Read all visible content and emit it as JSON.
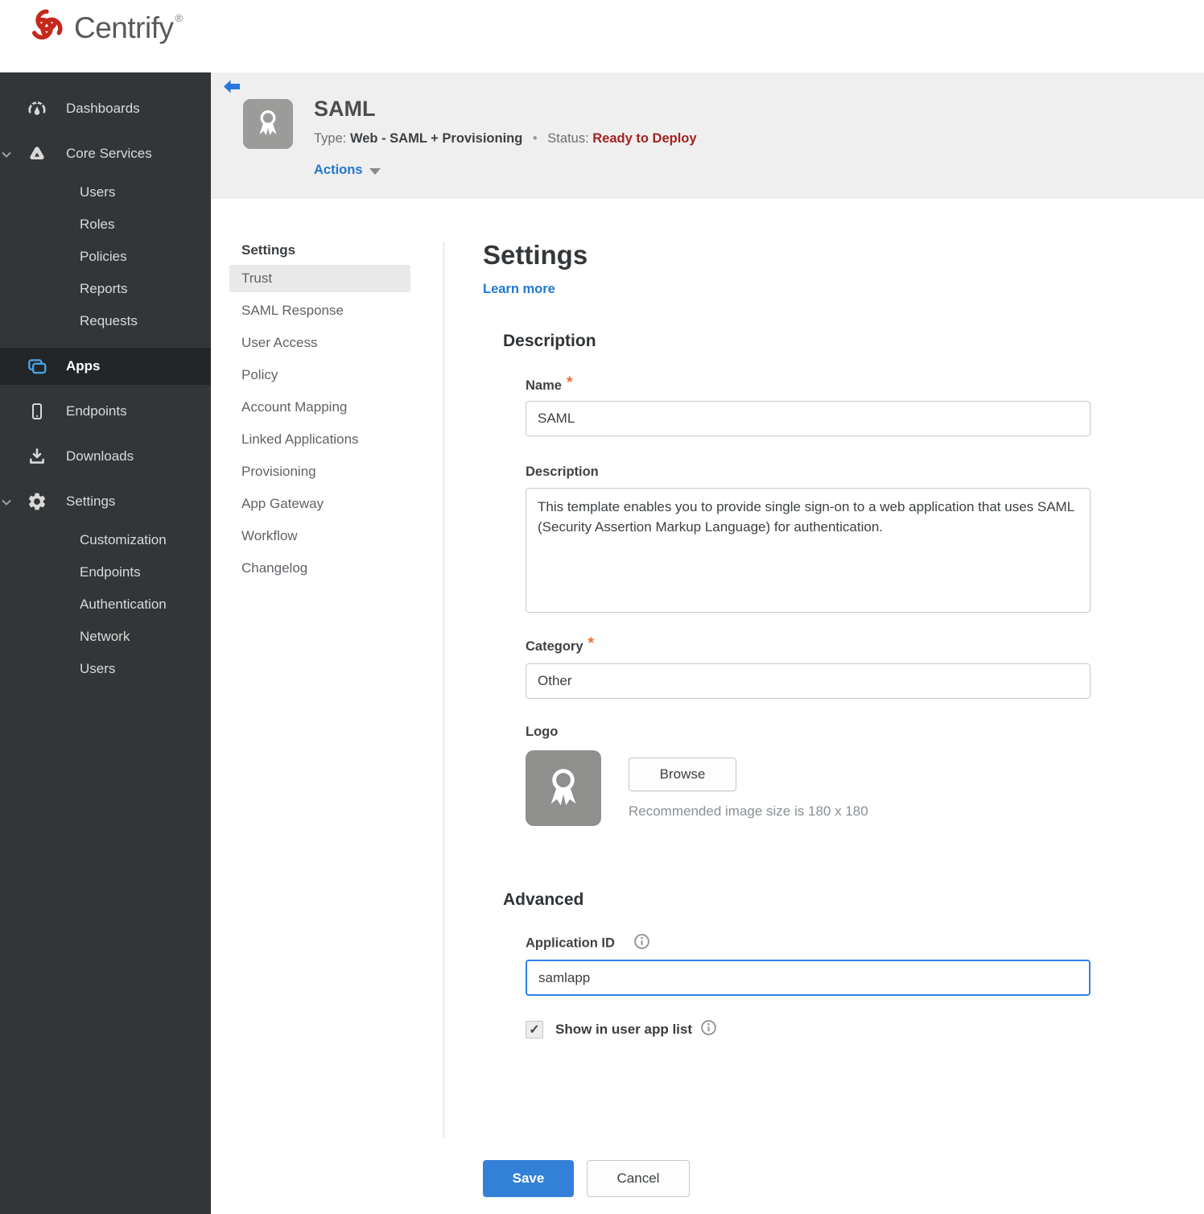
{
  "brand": {
    "name": "Centrify",
    "registered_mark": "®"
  },
  "sidebar": {
    "items": [
      {
        "label": "Dashboards",
        "icon": "gauge-icon"
      },
      {
        "label": "Core Services",
        "icon": "network-icon",
        "expanded": true,
        "children": [
          "Users",
          "Roles",
          "Policies",
          "Reports",
          "Requests"
        ]
      },
      {
        "label": "Apps",
        "icon": "apps-icon",
        "selected": true
      },
      {
        "label": "Endpoints",
        "icon": "phone-icon"
      },
      {
        "label": "Downloads",
        "icon": "download-icon"
      },
      {
        "label": "Settings",
        "icon": "gear-icon",
        "expanded": true,
        "children": [
          "Customization",
          "Endpoints",
          "Authentication",
          "Network",
          "Users"
        ]
      }
    ]
  },
  "app_header": {
    "title": "SAML",
    "type_label": "Type:",
    "type_value": "Web - SAML + Provisioning",
    "separator": "•",
    "status_label": "Status:",
    "status_value": "Ready to Deploy",
    "actions_label": "Actions"
  },
  "subnav": {
    "header": "Settings",
    "selected": "Trust",
    "items": [
      "Trust",
      "SAML Response",
      "User Access",
      "Policy",
      "Account Mapping",
      "Linked Applications",
      "Provisioning",
      "App Gateway",
      "Workflow",
      "Changelog"
    ]
  },
  "main": {
    "title": "Settings",
    "learn_more_label": "Learn more",
    "required_marker": "*",
    "description_section": {
      "heading": "Description",
      "name": {
        "label": "Name",
        "required": true,
        "value": "SAML"
      },
      "description": {
        "label": "Description",
        "value": "This template enables you to provide single sign-on to a web application that uses SAML (Security Assertion Markup Language) for authentication."
      },
      "category": {
        "label": "Category",
        "required": true,
        "value": "Other"
      },
      "logo": {
        "label": "Logo",
        "browse_label": "Browse",
        "hint": "Recommended image size is 180 x 180",
        "icon": "ribbon-badge-icon"
      }
    },
    "advanced_section": {
      "heading": "Advanced",
      "application_id": {
        "label": "Application ID",
        "value": "samlapp",
        "focused": true
      },
      "show_in_user_app_list": {
        "label": "Show in user app list",
        "checked": true
      }
    },
    "footer_buttons": {
      "save": "Save",
      "cancel": "Cancel"
    }
  },
  "colors": {
    "brand_red": "#c5281c",
    "accent_blue": "#2176d2",
    "save_blue": "#3380d8",
    "status_red": "#a32222",
    "required_orange": "#ed6a2d",
    "sidebar_bg": "#333639",
    "sidebar_selected_bg": "#232629",
    "apps_icon_blue": "#4aa2e2",
    "header_band_bg": "#efefef",
    "focus_border_blue": "#2f80e7"
  }
}
